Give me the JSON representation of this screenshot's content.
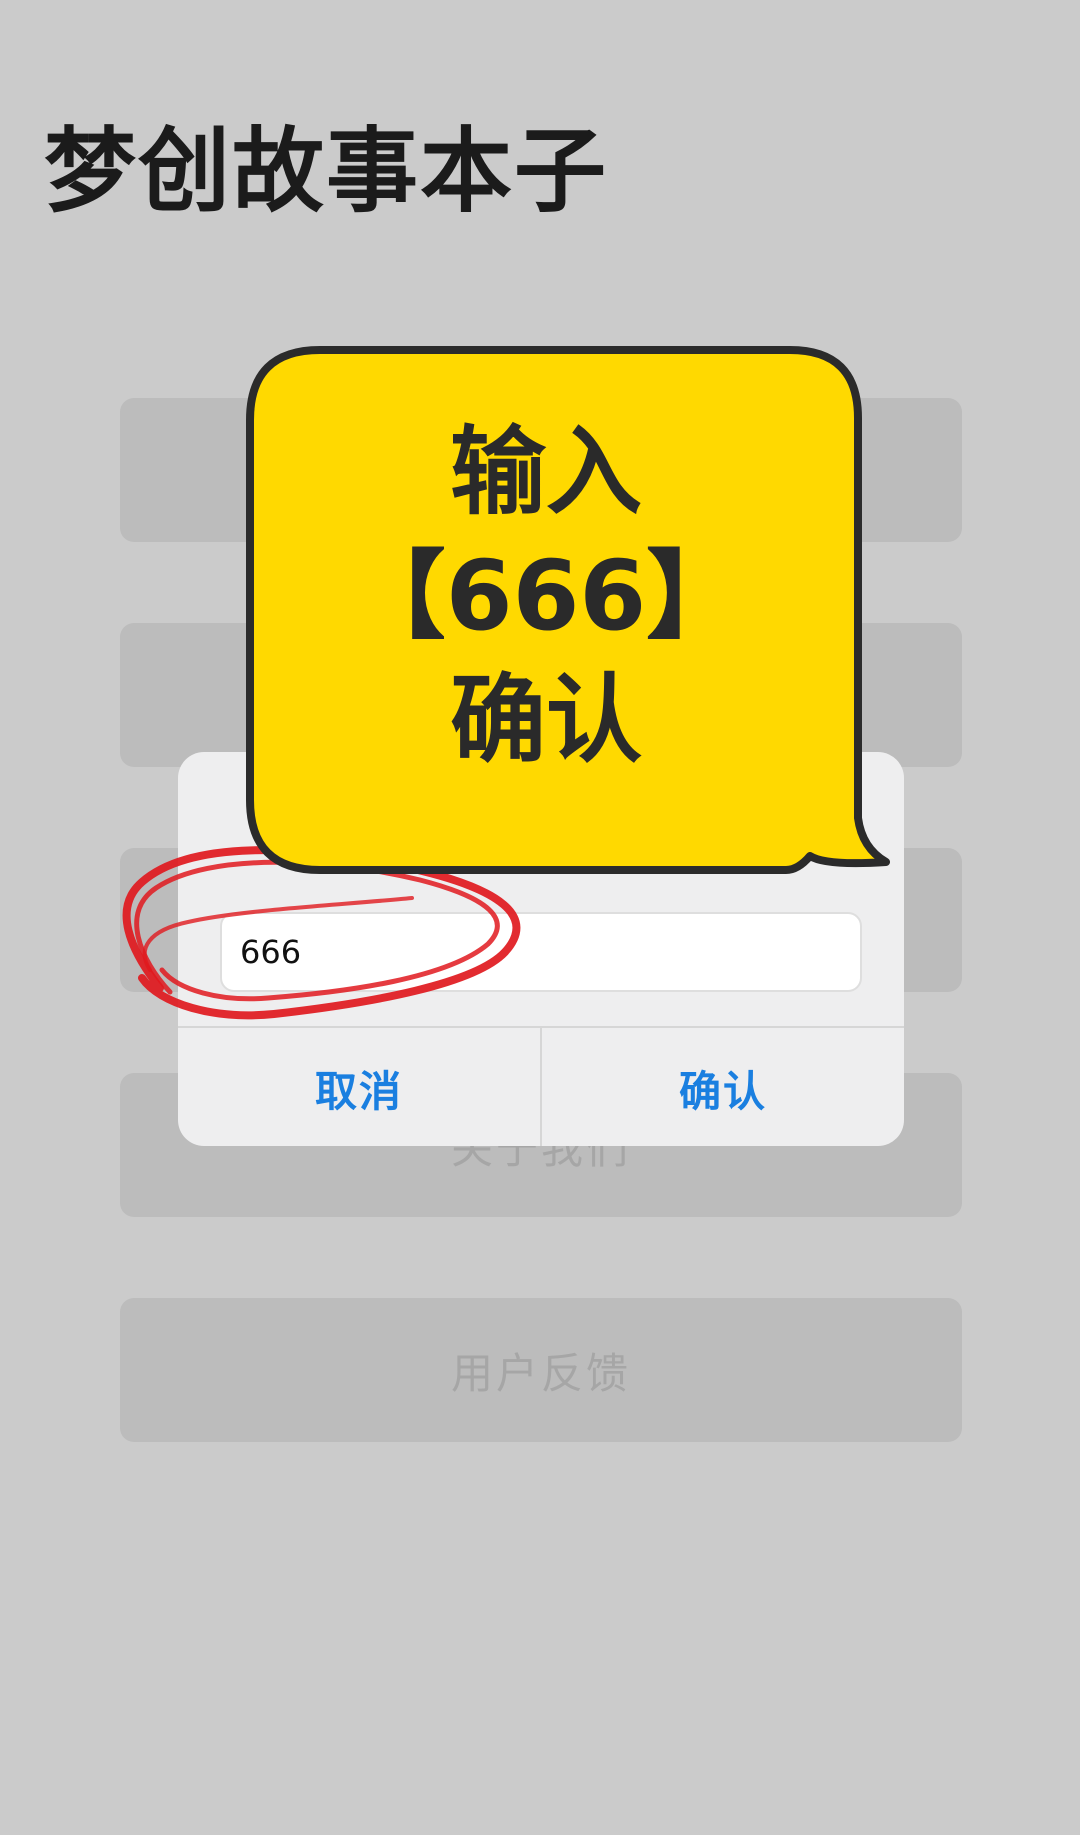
{
  "app": {
    "title": "梦创故事本子"
  },
  "menu": {
    "items": [
      {
        "label": ""
      },
      {
        "label": ""
      },
      {
        "label": ""
      },
      {
        "label": "关于我们"
      },
      {
        "label": "用户反馈"
      }
    ]
  },
  "dialog": {
    "input_value": "666",
    "cancel_label": "取消",
    "confirm_label": "确认"
  },
  "overlay": {
    "line1": "输入",
    "line2": "【666】",
    "line3": "确认",
    "bubble_color": "#ffd900",
    "circle_color": "#e0191e"
  },
  "colors": {
    "background": "#cbcbcb",
    "menu_button": "#bcbcbc",
    "dialog_action": "#1a7fe0"
  }
}
